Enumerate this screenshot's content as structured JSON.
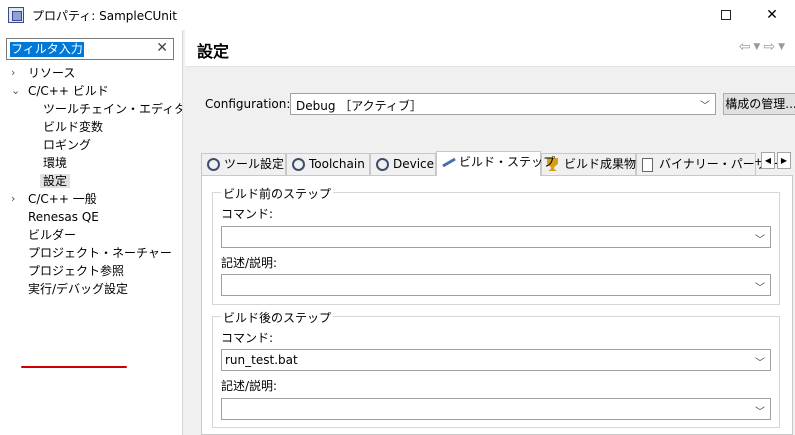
{
  "window": {
    "title": "プロパティ: SampleCUnit",
    "restore_icon": "restore-icon",
    "close_label": "✕"
  },
  "filter": {
    "value": "フィルタ入力",
    "clear_label": "✕"
  },
  "tree": [
    {
      "label": "リソース",
      "expand": ">"
    },
    {
      "label": "C/C++ ビルド",
      "expand": "v"
    },
    {
      "label": "ツールチェイン・エディター"
    },
    {
      "label": "ビルド変数"
    },
    {
      "label": "ロギング"
    },
    {
      "label": "環境"
    },
    {
      "label": "設定",
      "selected": true
    },
    {
      "label": "C/C++ 一般",
      "expand": ">"
    },
    {
      "label": "Renesas QE"
    },
    {
      "label": "ビルダー"
    },
    {
      "label": "プロジェクト・ネーチャー"
    },
    {
      "label": "プロジェクト参照"
    },
    {
      "label": "実行/デバッグ設定"
    }
  ],
  "header": {
    "title": "設定",
    "back_icon": "back-arrow-icon",
    "forward_icon": "forward-arrow-icon"
  },
  "config": {
    "label": "Configuration:",
    "value": "Debug ［アクティブ］",
    "manage_label": "構成の管理..."
  },
  "tabs": [
    {
      "label": "ツール設定",
      "icon": "gear-icon"
    },
    {
      "label": "Toolchain",
      "icon": "gear-icon"
    },
    {
      "label": "Device",
      "icon": "gear-icon"
    },
    {
      "label": "ビルド・ステップ",
      "icon": "build-step-icon",
      "active": true
    },
    {
      "label": "ビルド成果物",
      "icon": "trophy-icon"
    },
    {
      "label": "バイナリー・パーサー",
      "icon": "binary-icon"
    }
  ],
  "pre_build": {
    "title": "ビルド前のステップ",
    "command_label": "コマンド:",
    "command_value": "",
    "desc_label": "記述/説明:",
    "desc_value": ""
  },
  "post_build": {
    "title": "ビルド後のステップ",
    "command_label": "コマンド:",
    "command_value": "run_test.bat",
    "desc_label": "記述/説明:",
    "desc_value": ""
  },
  "colors": {
    "selection": "#0078d7",
    "underline": "#d00000"
  }
}
